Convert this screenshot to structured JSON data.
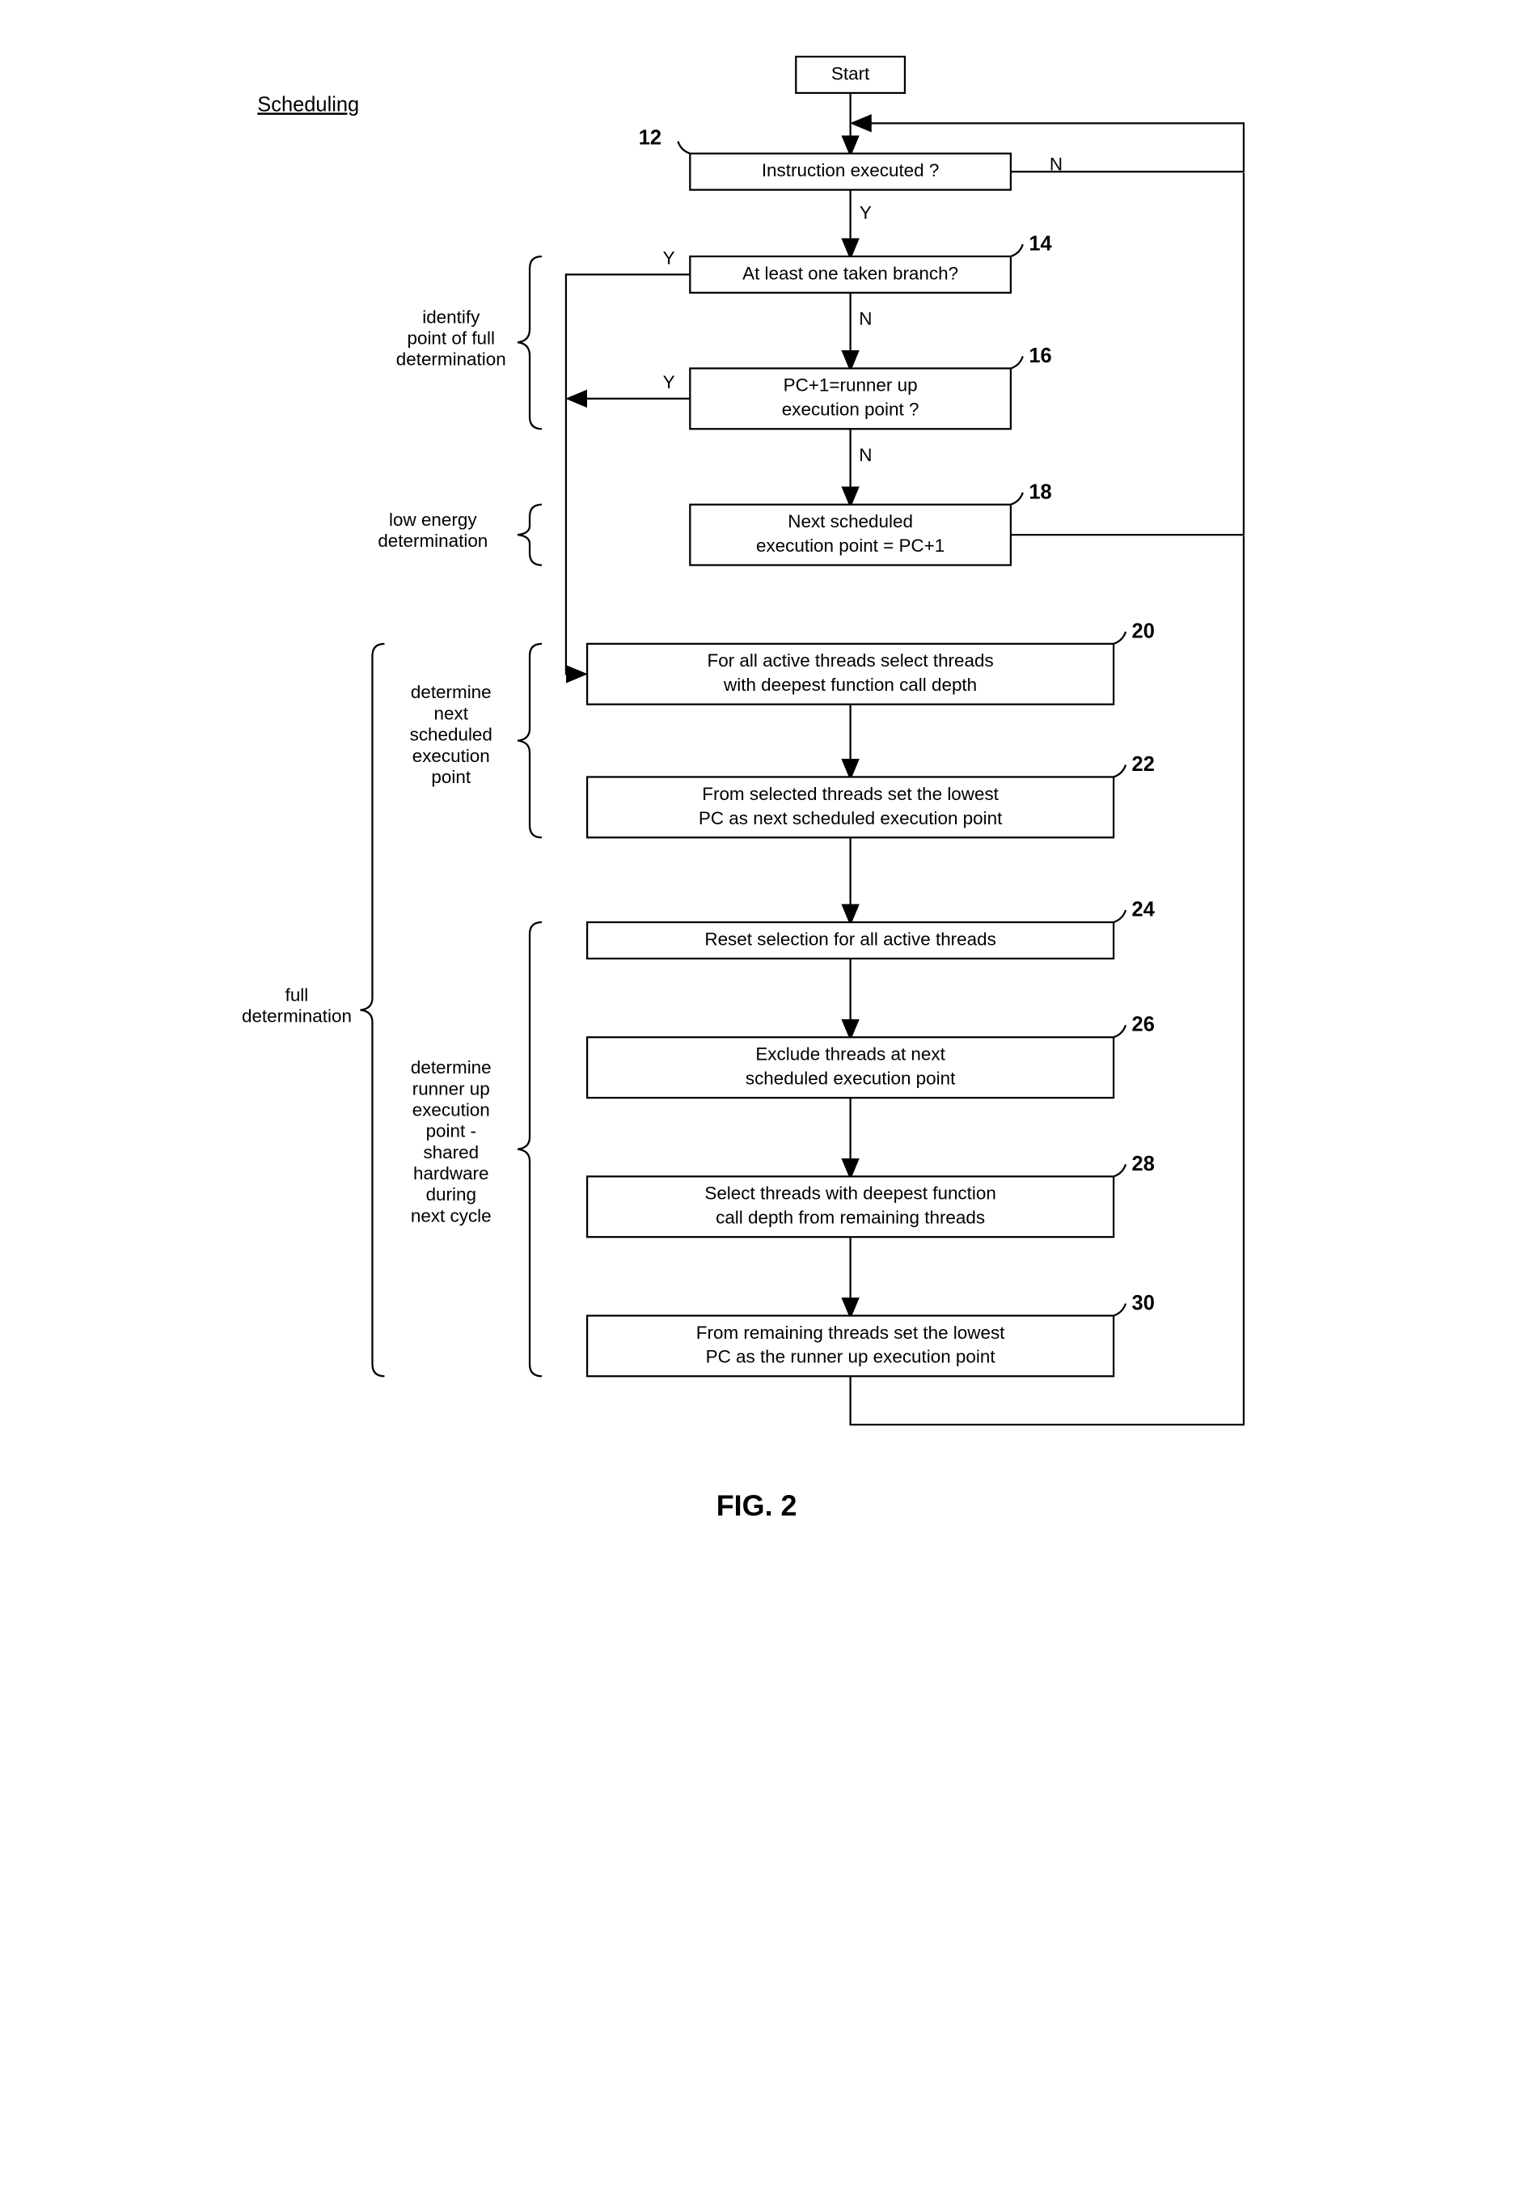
{
  "heading": "Scheduling",
  "figure": "FIG. 2",
  "nodes": {
    "start": "Start",
    "n12": "Instruction executed ?",
    "n14": "At least one taken branch?",
    "n16_l1": "PC+1=runner up",
    "n16_l2": "execution point ?",
    "n18_l1": "Next scheduled",
    "n18_l2": "execution point = PC+1",
    "n20_l1": "For all active threads select threads",
    "n20_l2": "with deepest function call depth",
    "n22_l1": "From selected threads set the lowest",
    "n22_l2": "PC as next scheduled execution point",
    "n24": "Reset selection for all active threads",
    "n26_l1": "Exclude threads at next",
    "n26_l2": "scheduled execution point",
    "n28_l1": "Select threads with deepest function",
    "n28_l2": "call depth from remaining threads",
    "n30_l1": "From remaining threads set the lowest",
    "n30_l2": "PC as the runner up execution point"
  },
  "labels": {
    "Y": "Y",
    "N": "N",
    "n12": "12",
    "n14": "14",
    "n16": "16",
    "n18": "18",
    "n20": "20",
    "n22": "22",
    "n24": "24",
    "n26": "26",
    "n28": "28",
    "n30": "30"
  },
  "braces": {
    "b1_l1": "identify",
    "b1_l2": "point of full",
    "b1_l3": "determination",
    "b2_l1": "low energy",
    "b2_l2": "determination",
    "b3_l1": "determine",
    "b3_l2": "next",
    "b3_l3": "scheduled",
    "b3_l4": "execution",
    "b3_l5": "point",
    "b4_l1": "full",
    "b4_l2": "determination",
    "b5_l1": "determine",
    "b5_l2": "runner up",
    "b5_l3": "execution",
    "b5_l4": "point -",
    "b5_l5": "shared",
    "b5_l6": "hardware",
    "b5_l7": "during",
    "b5_l8": "next cycle"
  }
}
